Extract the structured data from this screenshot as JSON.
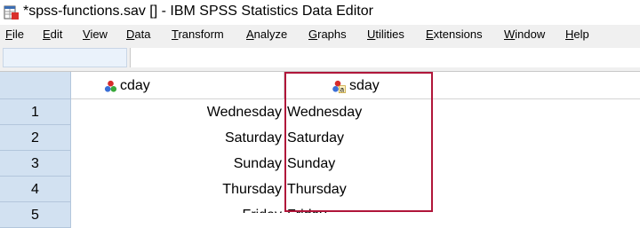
{
  "window": {
    "title": "*spss-functions.sav [] - IBM SPSS Statistics Data Editor"
  },
  "menu": {
    "items": [
      {
        "mn": "F",
        "rest": "ile"
      },
      {
        "mn": "E",
        "rest": "dit"
      },
      {
        "mn": "V",
        "rest": "iew"
      },
      {
        "mn": "D",
        "rest": "ata"
      },
      {
        "mn": "T",
        "rest": "ransform"
      },
      {
        "mn": "A",
        "rest": "nalyze"
      },
      {
        "mn": "G",
        "rest": "raphs"
      },
      {
        "mn": "U",
        "rest": "tilities"
      },
      {
        "mn": "E",
        "rest": "xtensions"
      },
      {
        "mn": "W",
        "rest": "indow"
      },
      {
        "mn": "H",
        "rest": "elp"
      }
    ]
  },
  "cell_editor": {
    "reference": "",
    "value": ""
  },
  "grid": {
    "columns": [
      {
        "name": "cday",
        "icon": "nominal-icon"
      },
      {
        "name": "sday",
        "icon": "nominal-string-icon"
      }
    ],
    "rows": [
      {
        "num": "1",
        "cday": "Wednesday",
        "sday": "Wednesday"
      },
      {
        "num": "2",
        "cday": "Saturday",
        "sday": "Saturday"
      },
      {
        "num": "3",
        "cday": "Sunday",
        "sday": "Sunday"
      },
      {
        "num": "4",
        "cday": "Thursday",
        "sday": "Thursday"
      },
      {
        "num": "5",
        "cday": "Friday",
        "sday": "Friday"
      }
    ]
  },
  "colors": {
    "highlight": "#b0163a",
    "row_header_bg": "#d2e1f1"
  }
}
